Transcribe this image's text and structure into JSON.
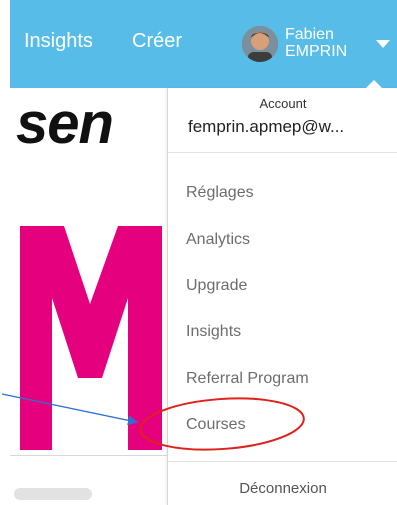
{
  "topbar": {
    "nav_items": [
      "Insights",
      "Créer"
    ],
    "user_first": "Fabien",
    "user_last": "EMPRIN",
    "bg_color": "#57bde8"
  },
  "content": {
    "heading_fragment": "sen",
    "letter_graphic": "M",
    "accent_color": "#e5007e"
  },
  "dropdown": {
    "account_label": "Account",
    "account_email": "femprin.apmep@w...",
    "items": [
      "Réglages",
      "Analytics",
      "Upgrade",
      "Insights",
      "Referral Program",
      "Courses"
    ],
    "logout": "Déconnexion"
  },
  "annotation": {
    "ring_color": "#e0201b",
    "arrow_color": "#2f6fd0"
  }
}
